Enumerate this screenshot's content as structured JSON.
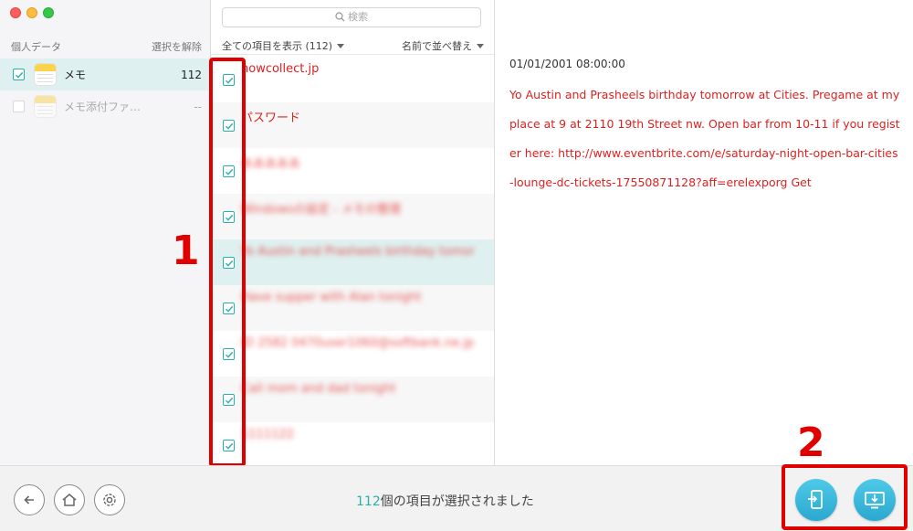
{
  "sidebar": {
    "header_label": "個人データ",
    "deselect_label": "選択を解除",
    "items": [
      {
        "name": "メモ",
        "count": "112",
        "checked": true,
        "active": true
      },
      {
        "name": "メモ添付ファ…",
        "count": "--",
        "checked": false,
        "active": false
      }
    ]
  },
  "search": {
    "placeholder": "検索"
  },
  "list": {
    "show_all_label": "全ての項目を表示 (112)",
    "sort_label": "名前で並べ替え",
    "rows": [
      {
        "title": "howcollect.jp",
        "blurred": false
      },
      {
        "title": "パスワード",
        "blurred": false
      },
      {
        "title": "あああああ",
        "blurred": true
      },
      {
        "title": "Windowsの設定 - メモの整理",
        "blurred": true
      },
      {
        "title": "Yo Austin and Prasheels birthday tomor",
        "blurred": true
      },
      {
        "title": "Have supper with Alan tonight",
        "blurred": true
      },
      {
        "title": "ID 2582 0470user1060@softbank.ne.jp",
        "blurred": true
      },
      {
        "title": "Call mom and dad tonight",
        "blurred": true
      },
      {
        "title": "1111122",
        "blurred": true
      }
    ]
  },
  "detail": {
    "date": "01/01/2001 08:00:00",
    "body": "Yo Austin and Prasheels birthday tomorrow at Cities. Pregame at my place at 9 at 2110 19th Street nw. Open bar from 10-11 if you register here: http://www.eventbrite.com/e/saturday-night-open-bar-cities-lounge-dc-tickets-17550871128?aff=erelexporg Get"
  },
  "annotations": {
    "one": "1",
    "two": "2"
  },
  "bottom": {
    "status_count": "112",
    "status_text": "個の項目が選択されました",
    "icons": [
      "back-icon",
      "home-icon",
      "settings-icon",
      "to-device-icon",
      "to-computer-icon"
    ]
  },
  "colors": {
    "accent": "#2bb0a8",
    "memo_text": "#e02020",
    "annotation": "#e00000",
    "action_button": "#3ab8de"
  }
}
